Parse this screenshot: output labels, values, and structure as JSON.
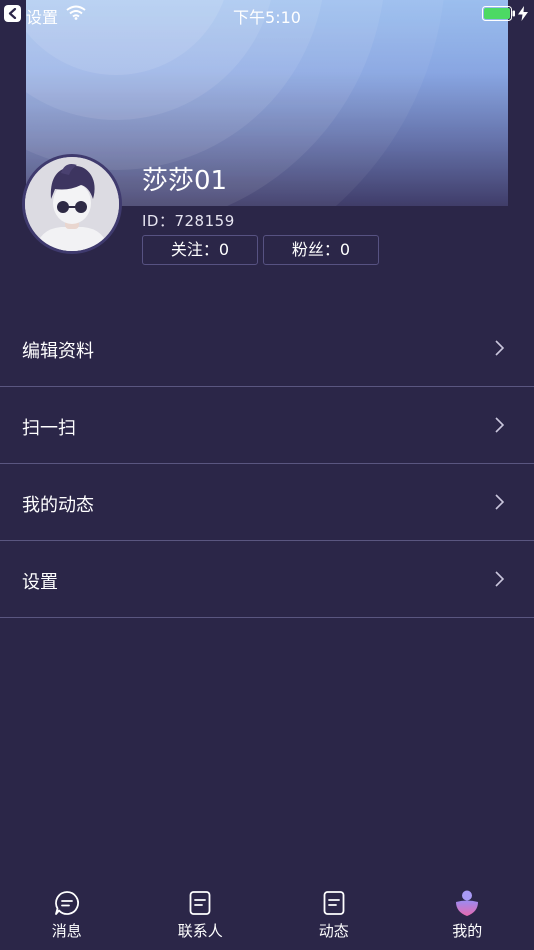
{
  "status_bar": {
    "back_label": "设置",
    "time": "下午5:10"
  },
  "profile": {
    "name": "莎莎01",
    "id_text": "ID：728159",
    "follow_text": "关注：0",
    "fans_text": "粉丝：0"
  },
  "menu": {
    "items": [
      {
        "label": "编辑资料",
        "icon": "chevron-right-icon"
      },
      {
        "label": "扫一扫",
        "icon": "chevron-right-icon"
      },
      {
        "label": "我的动态",
        "icon": "chevron-right-icon"
      },
      {
        "label": "设置",
        "icon": "chevron-right-icon"
      }
    ]
  },
  "tabbar": {
    "tabs": [
      {
        "label": "消息",
        "icon": "message-icon"
      },
      {
        "label": "联系人",
        "icon": "contacts-icon"
      },
      {
        "label": "动态",
        "icon": "feed-icon"
      },
      {
        "label": "我的",
        "icon": "profile-icon",
        "active": true
      }
    ]
  },
  "colors": {
    "background": "#2b2648",
    "divider": "#5a5680",
    "stat_border": "#575282",
    "battery_green": "#4cd964",
    "active_tab_top": "#9b8bf0",
    "active_tab_bottom": "#e66ab0"
  }
}
